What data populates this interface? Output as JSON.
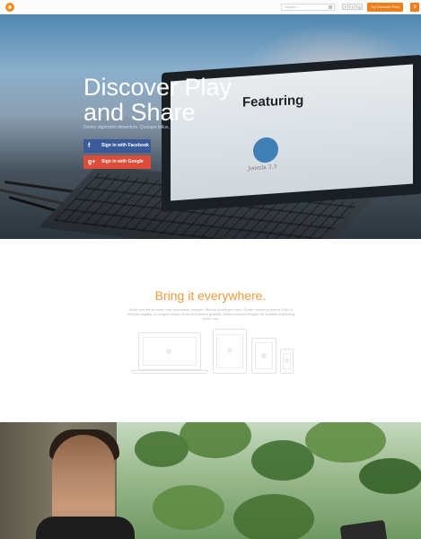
{
  "topbar": {
    "search_placeholder": "Search...",
    "social_icons": [
      "facebook-icon",
      "twitter-icon",
      "google-plus-icon"
    ],
    "try_button": "Try Discover Free",
    "menu_icon": "menu-icon"
  },
  "hero": {
    "title_line1": "Discover Play",
    "title_line2": "and Share",
    "subtitle": "Donec dignissim dimentum. Quisque tellus, eleifend blandit ac auctor congue.",
    "screen_heading": "Featuring",
    "screen_badge": "Joomla 3.3",
    "facebook_button": "Sign in with Facebook",
    "facebook_icon_glyph": "f",
    "google_button": "Sign in with Google",
    "google_icon_glyph": "g+",
    "colors": {
      "facebook": "#3b5a9a",
      "google": "#dd4b39",
      "accent": "#ef7f1a"
    }
  },
  "bring": {
    "title": "Bring it everywhere.",
    "body": "Nulla sed elit sit amet nunc accumsan aliquam. Mauris id suscipit nunc. Donec dictum pharetra. Duis a semper sagittis, ut congue neque sit amet pharetra gravida. Morbi euismod feugiat est sodales adipiscing lorem non."
  }
}
